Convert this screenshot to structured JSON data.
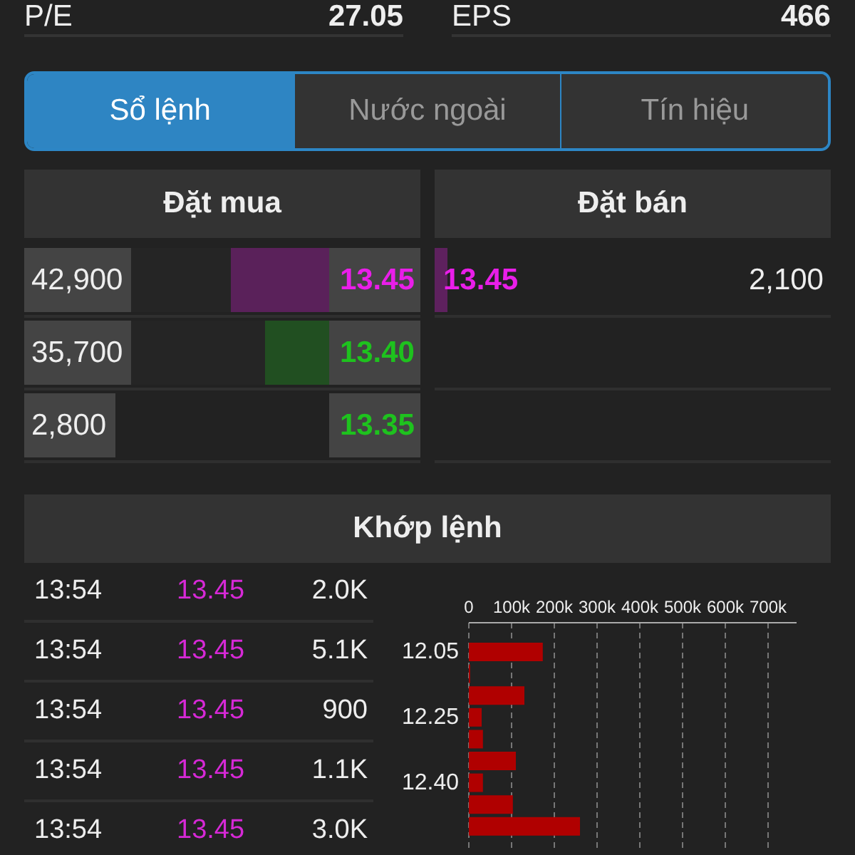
{
  "stats": [
    {
      "label": "P/E",
      "value": "27.05"
    },
    {
      "label": "EPS",
      "value": "466"
    }
  ],
  "tabs": [
    {
      "label": "Sổ lệnh",
      "selected": true
    },
    {
      "label": "Nước ngoài",
      "selected": false
    },
    {
      "label": "Tín hiệu",
      "selected": false
    }
  ],
  "order_book": {
    "bid_title": "Đặt mua",
    "ask_title": "Đặt bán",
    "bids": [
      {
        "volume": "42,900",
        "price": "13.45",
        "color": "#e91ee9",
        "level": 0.5
      },
      {
        "volume": "35,700",
        "price": "13.40",
        "color": "#1ec21e",
        "level": 0.33
      },
      {
        "volume": "2,800",
        "price": "13.35",
        "color": "#1ec21e"
      }
    ],
    "asks": [
      {
        "price": "13.45",
        "volume": "2,100",
        "color": "#e91ee9",
        "level": 0.04
      }
    ]
  },
  "matches": {
    "title": "Khớp lệnh",
    "rows": [
      {
        "time": "13:54",
        "price": "13.45",
        "volume": "2.0K"
      },
      {
        "time": "13:54",
        "price": "13.45",
        "volume": "5.1K"
      },
      {
        "time": "13:54",
        "price": "13.45",
        "volume": "900"
      },
      {
        "time": "13:54",
        "price": "13.45",
        "volume": "1.1K"
      },
      {
        "time": "13:54",
        "price": "13.45",
        "volume": "3.0K"
      }
    ],
    "chart_data": {
      "type": "bar",
      "orientation": "horizontal",
      "categories": [
        "12.05",
        null,
        null,
        "12.25",
        null,
        null,
        "12.40",
        null,
        null
      ],
      "grid": true,
      "series": [
        {
          "color": "#b00000",
          "values": [
            173000,
            3000,
            130000,
            30000,
            33000,
            110000,
            33000,
            103000,
            260000
          ]
        }
      ],
      "xlim": [
        0,
        700000
      ],
      "xticks": [
        {
          "value": 0,
          "label": "0"
        },
        {
          "value": 100000,
          "label": "100k"
        },
        {
          "value": 200000,
          "label": "200k"
        },
        {
          "value": 300000,
          "label": "300k"
        },
        {
          "value": 400000,
          "label": "400k"
        },
        {
          "value": 500000,
          "label": "500k"
        },
        {
          "value": 600000,
          "label": "600k"
        },
        {
          "value": 700000,
          "label": "700k"
        }
      ]
    }
  }
}
